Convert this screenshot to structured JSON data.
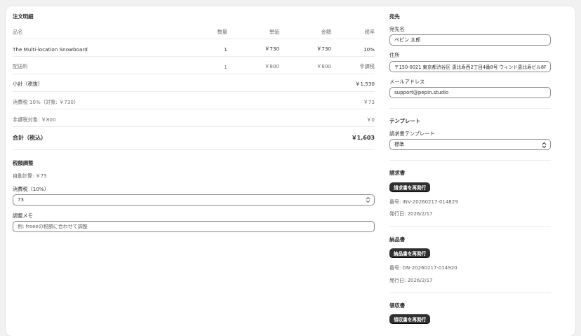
{
  "order": {
    "title": "注文明細",
    "headers": [
      "品名",
      "数量",
      "単価",
      "金額",
      "税率"
    ],
    "items": [
      {
        "name": "The Multi-location Snowboard",
        "qty": "1",
        "unit": "￥730",
        "amount": "￥730",
        "tax": "10%"
      },
      {
        "name": "配送料",
        "qty": "1",
        "unit": "￥800",
        "amount": "￥800",
        "tax": "非課税"
      }
    ],
    "subtotal_label": "小計（税抜）",
    "subtotal_value": "￥1,530",
    "tax_label": "消費税 10%（対象: ￥730）",
    "tax_value": "￥73",
    "nontax_label": "非課税対象: ￥800",
    "nontax_value": "￥0",
    "total_label": "合計（税込）",
    "total_value": "￥1,603"
  },
  "adjust": {
    "title": "税額調整",
    "auto_calc": "自動計算: ￥73",
    "tax_label": "消費税（10%）",
    "tax_value": "73",
    "memo_label": "調整メモ",
    "memo_placeholder": "例: freeeの税額に合わせて調整"
  },
  "recipient": {
    "title": "宛先",
    "name_label": "宛先名",
    "name_value": "ペピン 太郎",
    "address_label": "住所",
    "address_value": "〒150-0021 東京都渋谷区 恵比寿西2丁目4番8号 ウィンド恵比寿ビル8F",
    "email_label": "メールアドレス",
    "email_value": "support@pepin.studio"
  },
  "template": {
    "title": "テンプレート",
    "label": "請求書テンプレート",
    "selected": "標準"
  },
  "invoice": {
    "title": "請求書",
    "button": "請求書を再発行",
    "number": "番号: INV-20260217-014829",
    "date": "発行日: 2026/2/17"
  },
  "delivery": {
    "title": "納品書",
    "button": "納品書を再発行",
    "number": "番号: DN-20260217-014920",
    "date": "発行日: 2026/2/17"
  },
  "receipt": {
    "title": "領収書",
    "button": "領収書を再発行"
  }
}
